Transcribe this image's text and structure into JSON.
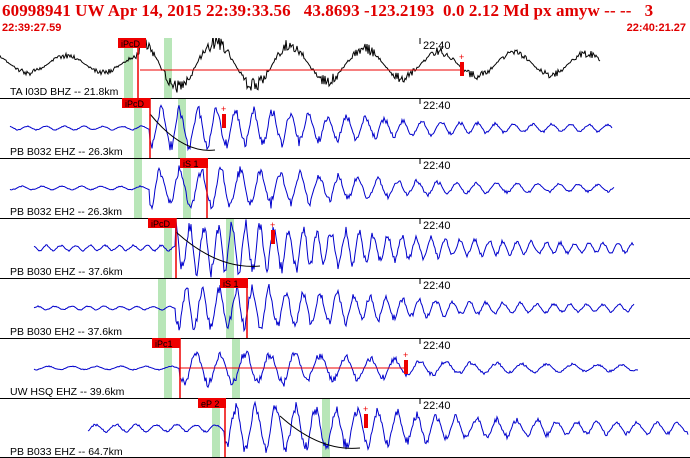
{
  "header": {
    "title": "60998941 UW Apr 14, 2015 22:39:33.56   43.8693 -123.2193  0.0 2.12 Md px amyw -- --   3",
    "start_time": "22:39:27.59",
    "end_time": "22:40:21.27"
  },
  "minute_label": "22:40",
  "colors": {
    "header_text": "#e00000",
    "first_trace": "#000000",
    "trace": "#0000cc",
    "pick_box": "#ee0000",
    "window_band": "#b8e6b8",
    "grid": "#000000"
  },
  "traces": [
    {
      "label": "TA I03D BHZ -- 21.8km",
      "color": "black",
      "pick": {
        "label": "iPcD"
      },
      "features": [
        "coda-duration-line",
        "amplitude-pick"
      ]
    },
    {
      "label": "PB B032 EHZ -- 26.3km",
      "color": "blue",
      "pick": {
        "label": "iPcD"
      },
      "features": [
        "decay-curve",
        "amplitude-pick"
      ]
    },
    {
      "label": "PB B032 EH2 -- 26.3km",
      "color": "blue",
      "pick": {
        "label": "iS 1"
      },
      "features": []
    },
    {
      "label": "PB B030 EHZ -- 37.6km",
      "color": "blue",
      "pick": {
        "label": "iPcD"
      },
      "features": [
        "decay-curve",
        "amplitude-pick"
      ]
    },
    {
      "label": "PB B030 EH2 -- 37.6km",
      "color": "blue",
      "pick": {
        "label": "iS 1"
      },
      "features": []
    },
    {
      "label": "UW HSQ EHZ -- 39.6km",
      "color": "blue",
      "pick": {
        "label": "iPc1"
      },
      "features": [
        "coda-duration-line",
        "amplitude-pick"
      ]
    },
    {
      "label": "PB B033 EHZ -- 64.7km",
      "color": "blue",
      "pick": {
        "label": "eP 2"
      },
      "features": [
        "decay-curve",
        "amplitude-pick"
      ]
    }
  ]
}
